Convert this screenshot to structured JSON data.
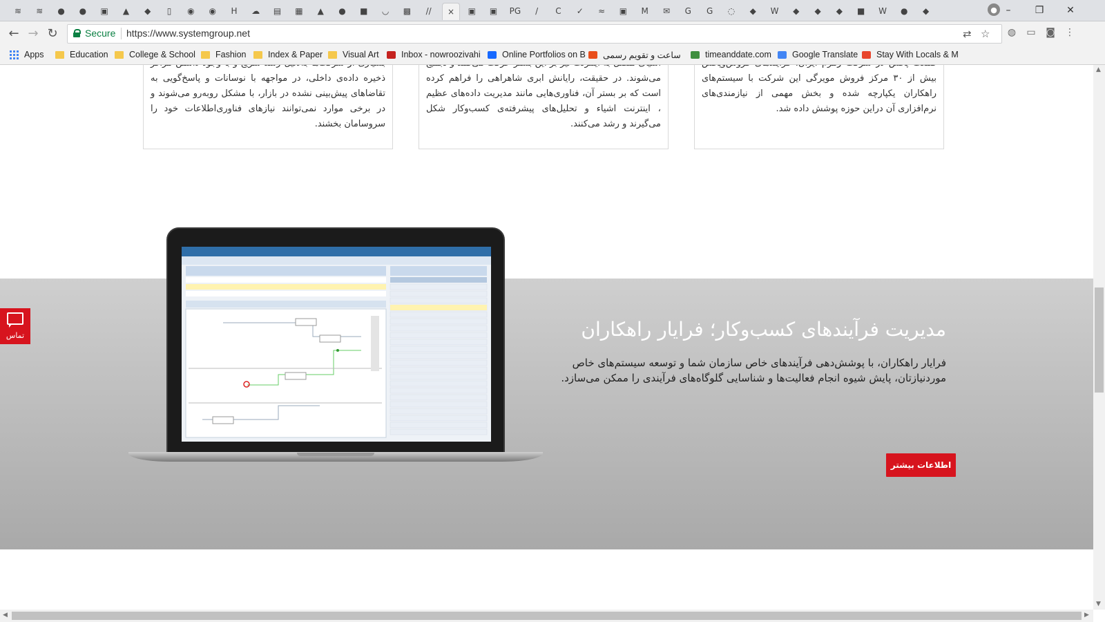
{
  "browser": {
    "tabs": [
      {
        "icon": "≋",
        "active": false
      },
      {
        "icon": "≋",
        "active": false
      },
      {
        "icon": "●",
        "active": false
      },
      {
        "icon": "●",
        "active": false
      },
      {
        "icon": "▣",
        "active": false
      },
      {
        "icon": "▲",
        "active": false
      },
      {
        "icon": "◆",
        "active": false
      },
      {
        "icon": "▯",
        "active": false
      },
      {
        "icon": "◉",
        "active": false
      },
      {
        "icon": "◉",
        "active": false
      },
      {
        "icon": "H",
        "active": false
      },
      {
        "icon": "☁",
        "active": false
      },
      {
        "icon": "▤",
        "active": false
      },
      {
        "icon": "▦",
        "active": false
      },
      {
        "icon": "▲",
        "active": false
      },
      {
        "icon": "●",
        "active": false
      },
      {
        "icon": "■",
        "active": false
      },
      {
        "icon": "◡",
        "active": false
      },
      {
        "icon": "▩",
        "active": false
      },
      {
        "icon": "//",
        "active": false
      },
      {
        "icon": "×",
        "active": true
      },
      {
        "icon": "▣",
        "active": false
      },
      {
        "icon": "▣",
        "active": false
      },
      {
        "icon": "PG",
        "active": false
      },
      {
        "icon": "/",
        "active": false
      },
      {
        "icon": "C",
        "active": false
      },
      {
        "icon": "✓",
        "active": false
      },
      {
        "icon": "≈",
        "active": false
      },
      {
        "icon": "▣",
        "active": false
      },
      {
        "icon": "M",
        "active": false
      },
      {
        "icon": "✉",
        "active": false
      },
      {
        "icon": "G",
        "active": false
      },
      {
        "icon": "G",
        "active": false
      },
      {
        "icon": "◌",
        "active": false
      },
      {
        "icon": "◆",
        "active": false
      },
      {
        "icon": "W",
        "active": false
      },
      {
        "icon": "◆",
        "active": false
      },
      {
        "icon": "◆",
        "active": false
      },
      {
        "icon": "◆",
        "active": false
      },
      {
        "icon": "■",
        "active": false
      },
      {
        "icon": "W",
        "active": false
      },
      {
        "icon": "●",
        "active": false
      },
      {
        "icon": "◆",
        "active": false
      }
    ],
    "window_controls": {
      "minimize": "–",
      "restore": "❐",
      "close": "✕"
    },
    "address": {
      "secure_label": "Secure",
      "url": "https://www.systemgroup.net"
    },
    "bookmarks": [
      {
        "label": "Apps",
        "icon": "apps-grid"
      },
      {
        "label": "Education",
        "icon": "folder"
      },
      {
        "label": "College & School",
        "icon": "folder"
      },
      {
        "label": "Fashion",
        "icon": "folder"
      },
      {
        "label": "Index & Paper",
        "icon": "folder"
      },
      {
        "label": "Visual Art",
        "icon": "folder"
      },
      {
        "label": "Inbox - nowroozivahi",
        "icon": "gmail"
      },
      {
        "label": "Online Portfolios on B",
        "icon": "behance"
      },
      {
        "label": "ساعت و تقویم رسمی",
        "icon": "time-ir"
      },
      {
        "label": "timeanddate.com",
        "icon": "timeanddate"
      },
      {
        "label": "Google Translate",
        "icon": "translate"
      },
      {
        "label": "Stay With Locals & M",
        "icon": "couchsurfing"
      }
    ]
  },
  "cards": [
    {
      "text": "بسیاری از شرکت‌ها به‌دلیل رشد سریع و با وجود داشتن مراکز ذخیره داده‌ی داخلی، در مواجهه با نوسانات و پاسخ‌گویی به تقاضاهای پیش‌بینی نشده در بازار، با مشکل روبه‌رو می‌شوند و در برخی موارد نمی‌توانند نیازهای فناوری‌اطلاعات خود را سروسامان بخشند."
    },
    {
      "text": "اشیای متصل به اینترنت نیز بر این بستر حرکت می‌کنند و تجمیع می‌شوند. در حقیقت، رایانش ابری شاهراهی را فراهم کرده است که بر بستر آن، فناوری‌هایی مانند مدیریت داده‌های عظیم ، اینترنت اشیاء و تحلیل‌های پیشرفته‌ی کسب‌وکار شکل می‌گیرند و رشد می‌کنند."
    },
    {
      "text": "صنعت پخش در شرکت زمزم ایران، فرایندهای فروش‌وپخش بیش از ۳۰ مرکز فروش مویرگی این شرکت با سیستم‌های راهکاران یکپارچه شده و بخش مهمی از نیازمندی‌های نرم‌افزاری آن دراین حوزه پوشش داده شد."
    }
  ],
  "hero": {
    "title": "مدیریت فرآیندهای کسب‌وکار؛ فرایار راهکاران",
    "description": "فرایار راهکاران، با پوشش‌دهی فرآیندهای خاص سازمان شما و توسعه سیستم‌های خاص موردنیازتان، پایش شیوه انجام فعالیت‌ها و شناسایی گلوگاه‌های فرآیندی را ممکن می‌سازد.",
    "button": "اطلاعات بیشتر"
  },
  "contact": {
    "label": "تماس"
  },
  "colors": {
    "accent": "#d7141e",
    "secure": "#0b8043",
    "band_top": "#cfcfcf",
    "band_bottom": "#a9a9a9"
  }
}
